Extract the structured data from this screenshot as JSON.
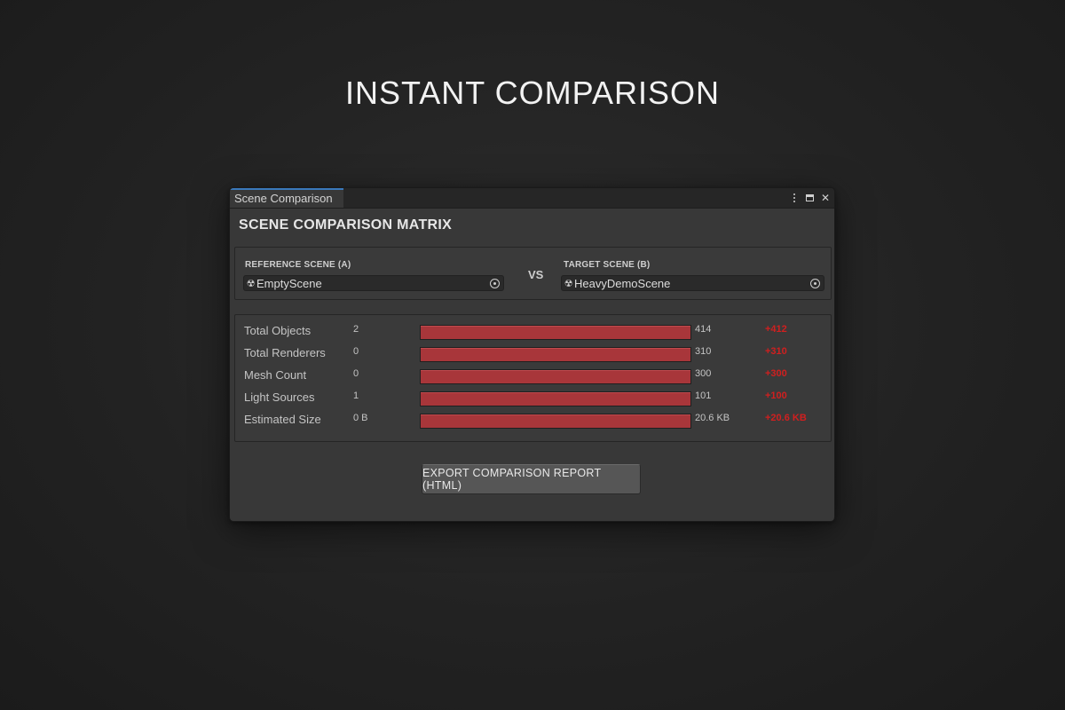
{
  "hero": {
    "title": "INSTANT COMPARISON"
  },
  "window": {
    "tab_label": "Scene Comparison",
    "title": "SCENE COMPARISON MATRIX",
    "controls": {
      "menu_icon": "kebab-menu-icon",
      "maximize_icon": "maximize-icon",
      "close_icon": "close-icon",
      "close_glyph": "✕"
    }
  },
  "scenes": {
    "reference": {
      "label": "REFERENCE SCENE (A)",
      "value": "EmptyScene",
      "icon": "scene-asset-icon",
      "icon_glyph": "☢"
    },
    "vs": "VS",
    "target": {
      "label": "TARGET SCENE (B)",
      "value": "HeavyDemoScene",
      "icon": "scene-asset-icon",
      "icon_glyph": "☢"
    }
  },
  "metrics": [
    {
      "label": "Total Objects",
      "a": "2",
      "b": "414",
      "diff": "+412",
      "fill": 1.0
    },
    {
      "label": "Total Renderers",
      "a": "0",
      "b": "310",
      "diff": "+310",
      "fill": 1.0
    },
    {
      "label": "Mesh Count",
      "a": "0",
      "b": "300",
      "diff": "+300",
      "fill": 1.0
    },
    {
      "label": "Light Sources",
      "a": "1",
      "b": "101",
      "diff": "+100",
      "fill": 1.0
    },
    {
      "label": "Estimated Size",
      "a": "0 B",
      "b": "20.6 KB",
      "diff": "+20.6 KB",
      "fill": 1.0
    }
  ],
  "actions": {
    "export_label": "EXPORT COMPARISON REPORT (HTML)"
  },
  "colors": {
    "bar_fill": "#a8363a",
    "diff_text": "#d11f1f",
    "tab_accent": "#3a79bb"
  }
}
